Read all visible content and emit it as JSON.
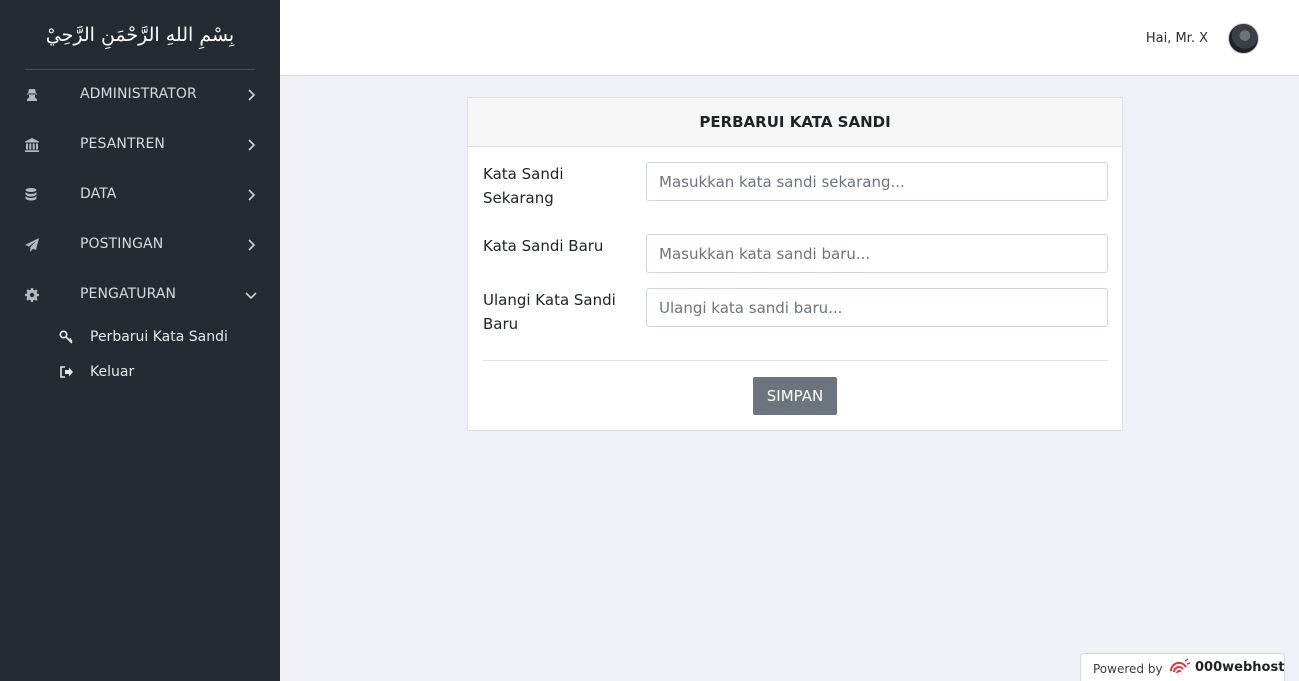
{
  "sidebar": {
    "brand": "بِسْمِ اللهِ الرَّحْمَنِ الرَّحِيْ",
    "menu": [
      {
        "label": "ADMINISTRATOR",
        "icon": "user-secret-icon",
        "expanded": false
      },
      {
        "label": "PESANTREN",
        "icon": "institution-icon",
        "expanded": false
      },
      {
        "label": "DATA",
        "icon": "database-icon",
        "expanded": false
      },
      {
        "label": "POSTINGAN",
        "icon": "paper-plane-icon",
        "expanded": false
      },
      {
        "label": "PENGATURAN",
        "icon": "gear-icon",
        "expanded": true
      }
    ],
    "submenu": [
      {
        "label": "Perbarui Kata Sandi",
        "icon": "key-icon"
      },
      {
        "label": "Keluar",
        "icon": "sign-out-icon"
      }
    ]
  },
  "topbar": {
    "greeting": "Hai, Mr. X"
  },
  "card": {
    "title": "PERBARUI KATA SANDI",
    "fields": [
      {
        "label": "Kata Sandi Sekarang",
        "placeholder": "Masukkan kata sandi sekarang...",
        "value": ""
      },
      {
        "label": "Kata Sandi Baru",
        "placeholder": "Masukkan kata sandi baru...",
        "value": ""
      },
      {
        "label": "Ulangi Kata Sandi Baru",
        "placeholder": "Ulangi kata sandi baru...",
        "value": ""
      }
    ],
    "submit_label": "SIMPAN"
  },
  "footer": {
    "powered_by": "Powered by",
    "brand": "000webhost"
  },
  "colors": {
    "sidebar_bg": "#262a33",
    "page_bg": "#f0f1f6",
    "button_bg": "#6c757d"
  }
}
